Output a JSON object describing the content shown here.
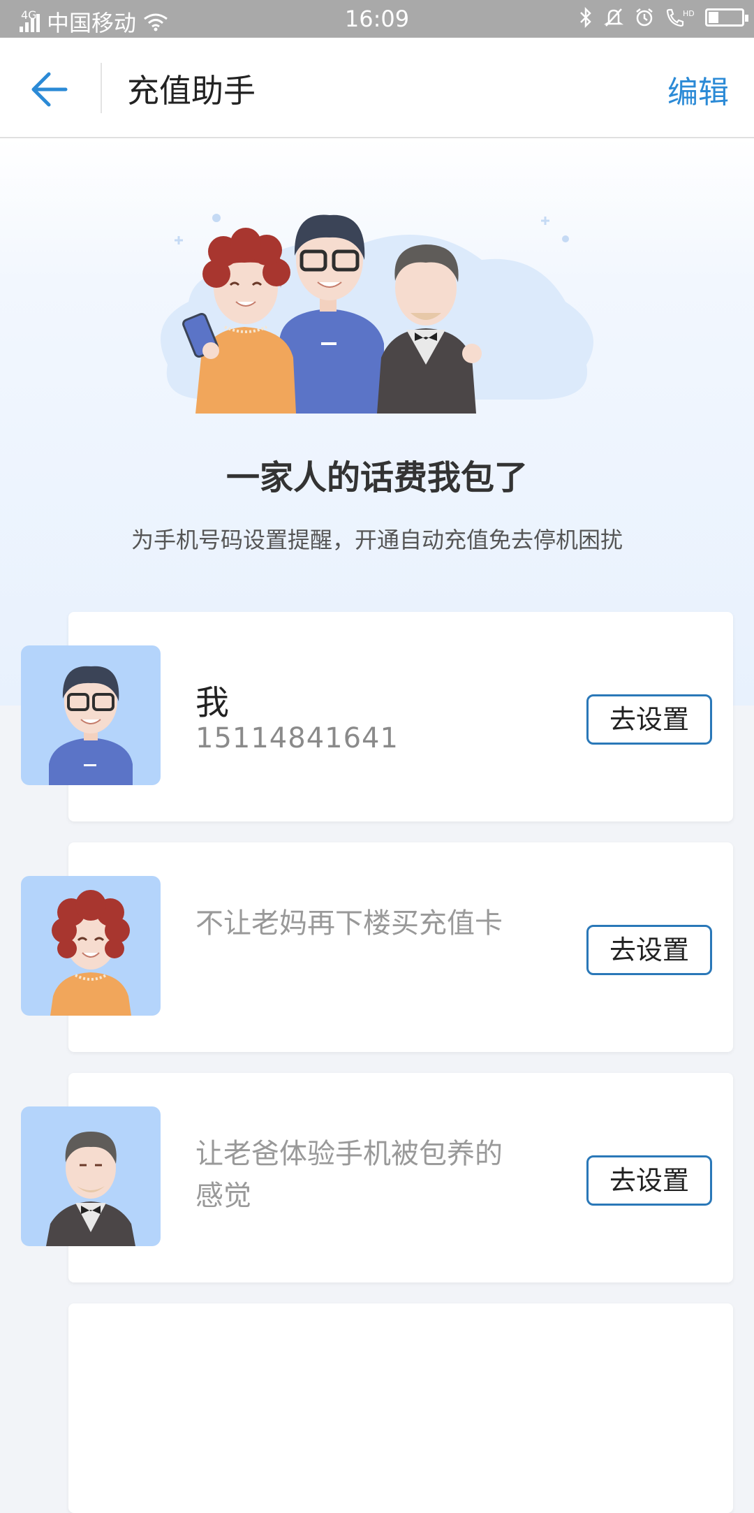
{
  "status_bar": {
    "network_type": "4G",
    "carrier": "中国移动",
    "time": "16:09",
    "battery_level": 0.3,
    "icons": [
      "signal-icon",
      "wifi-icon",
      "bluetooth-icon",
      "mute-bell-icon",
      "alarm-icon",
      "hd-call-icon",
      "battery-icon"
    ]
  },
  "header": {
    "title": "充值助手",
    "edit_label": "编辑",
    "accent_color": "#2b8ad6"
  },
  "hero": {
    "headline": "一家人的话费我包了",
    "subline": "为手机号码设置提醒，开通自动充值免去停机困扰"
  },
  "contacts": [
    {
      "name": "我",
      "phone": "15114841641",
      "button": "去设置"
    },
    {
      "description": "不让老妈再下楼买充值卡",
      "button": "去设置"
    },
    {
      "description": "让老爸体验手机被包养的感觉",
      "button": "去设置"
    }
  ]
}
